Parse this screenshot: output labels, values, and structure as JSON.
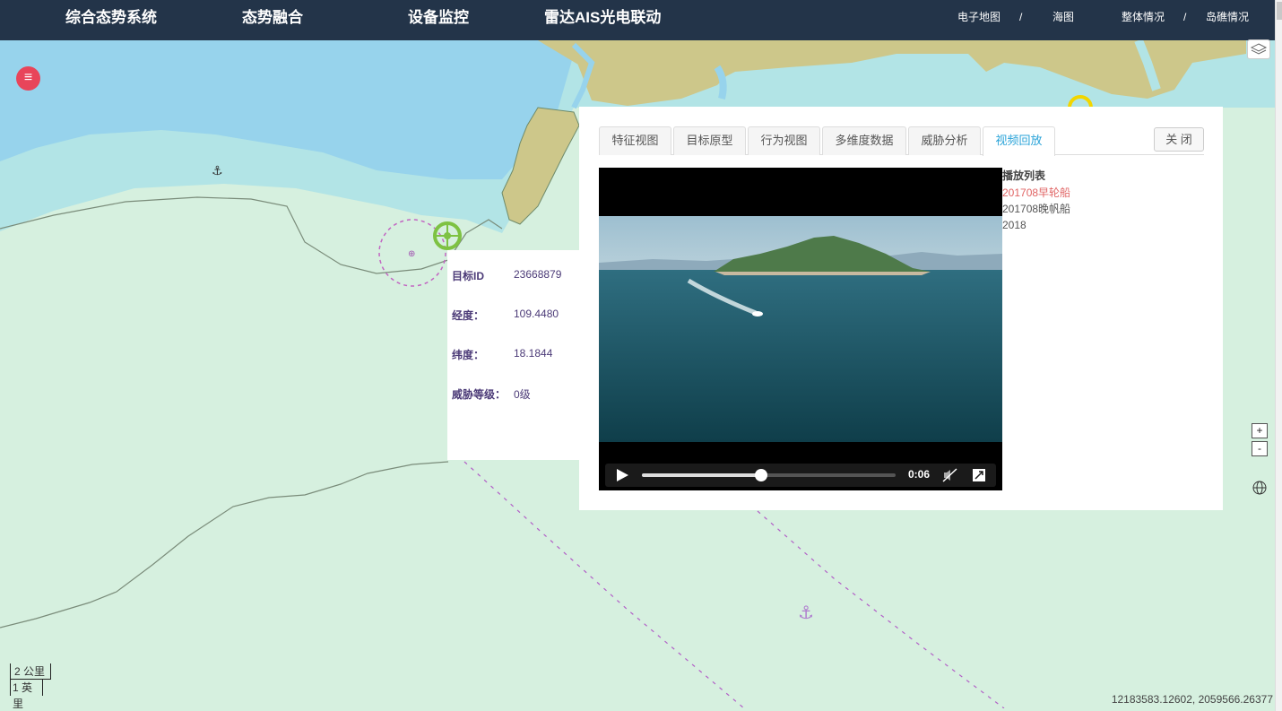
{
  "header": {
    "nav": [
      "综合态势系统",
      "态势融合",
      "设备监控",
      "雷达AIS光电联动"
    ],
    "right_links": [
      "电子地图",
      "海图",
      "整体情况",
      "岛礁情况"
    ],
    "separator": "/"
  },
  "map": {
    "menu_icon": "hamburger-menu-icon",
    "zoom_in": "+",
    "zoom_out": "-",
    "scale_km": "2 公里",
    "scale_mi": "1 英里",
    "coordinates": "12183583.12602, 2059566.26377",
    "colors": {
      "deep_water": "#97d3ec",
      "shallow_water": "#b2e4e6",
      "sea": "#d6f0df",
      "land": "#cdc78a"
    }
  },
  "target_info": {
    "rows": [
      {
        "label": "目标ID",
        "value": "23668879"
      },
      {
        "label": "经度：",
        "value": "109.4480"
      },
      {
        "label": "纬度：",
        "value": "18.1844"
      },
      {
        "label": "威胁等级：",
        "value": "0级"
      }
    ]
  },
  "detail_panel": {
    "tabs": [
      "特征视图",
      "目标原型",
      "行为视图",
      "多维度数据",
      "威胁分析",
      "视频回放"
    ],
    "active_tab": "视频回放",
    "close_label": "关 闭",
    "video": {
      "time": "0:06",
      "progress": 0.47
    },
    "playlist": {
      "title": "播放列表",
      "items": [
        "201708早轮船",
        "201708晚帆船",
        "2018"
      ],
      "active_index": 0
    }
  }
}
